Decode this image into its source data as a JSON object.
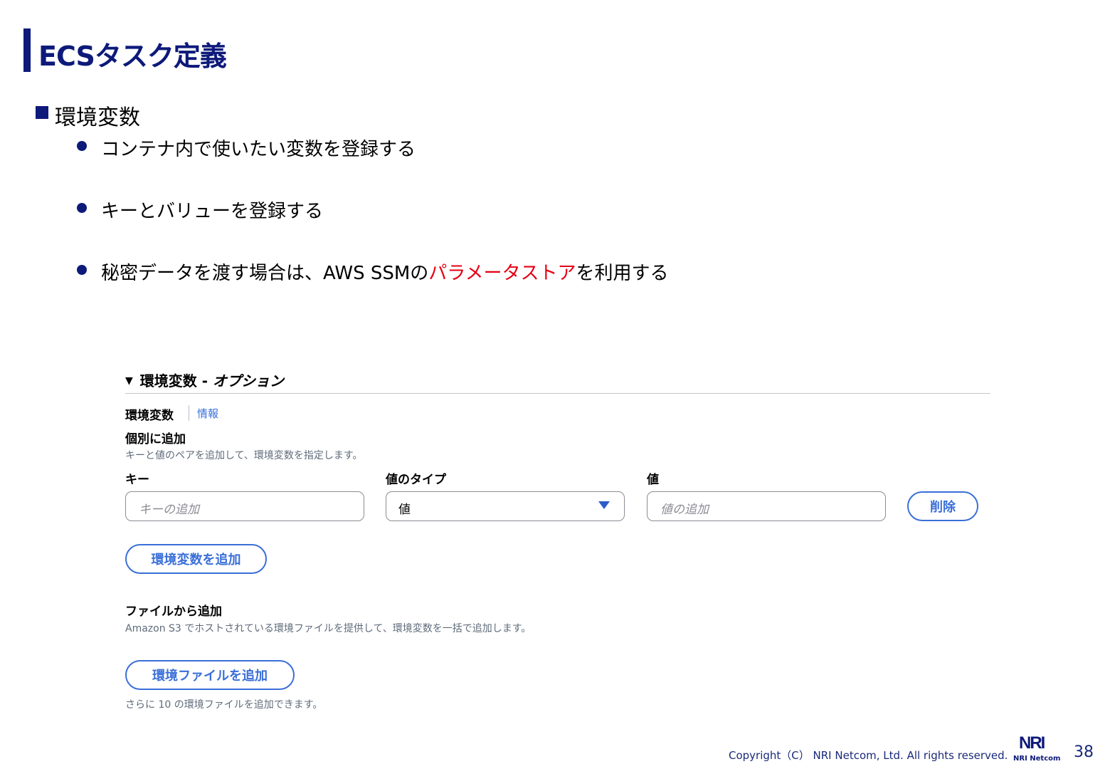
{
  "slide": {
    "title": "ECSタスク定義",
    "section_title": "環境変数",
    "bullets": [
      {
        "text": "コンテナ内で使いたい変数を登録する"
      },
      {
        "text": "キーとバリューを登録する"
      },
      {
        "pre": "秘密データを渡す場合は、AWS SSMの",
        "highlight": "パラメータストア",
        "post": "を利用する"
      }
    ]
  },
  "console": {
    "section_label": "環境変数",
    "section_label_sep": " - ",
    "section_option": "オプション",
    "env_label": "環境変数",
    "info_link": "情報",
    "individual_heading": "個別に追加",
    "individual_desc": "キーと値のペアを追加して、環境変数を指定します。",
    "columns": {
      "key": "キー",
      "value_type": "値のタイプ",
      "value": "値"
    },
    "key_placeholder": "キーの追加",
    "value_type_selected": "値",
    "value_placeholder": "値の追加",
    "delete_button": "削除",
    "add_env_button": "環境変数を追加",
    "file_heading": "ファイルから追加",
    "file_desc": "Amazon S3 でホストされている環境ファイルを提供して、環境変数を一括で追加します。",
    "add_file_button": "環境ファイルを追加",
    "file_remaining": "さらに 10 の環境ファイルを追加できます。"
  },
  "footer": {
    "copyright": "Copyright（C） NRI Netcom, Ltd. All rights reserved.",
    "logo_mark": "NRI",
    "logo_text": "NRI Netcom",
    "page_number": "38"
  },
  "colors": {
    "brand_navy": "#0d1a7a",
    "highlight_red": "#e60012",
    "console_blue": "#3a6fd8",
    "muted_text": "#5f6b7a"
  }
}
